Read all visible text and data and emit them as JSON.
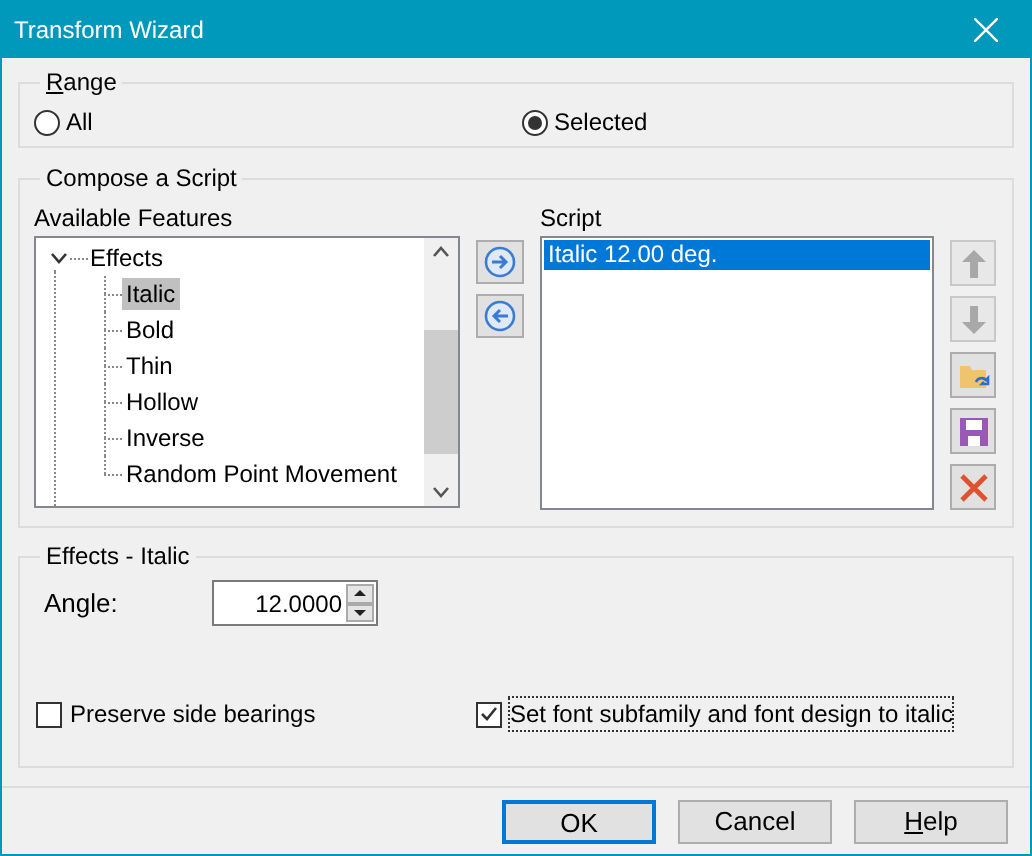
{
  "window": {
    "title": "Transform Wizard"
  },
  "range": {
    "title": "Range",
    "mnemonic": true,
    "options": [
      {
        "label": "All",
        "selected": false
      },
      {
        "label": "Selected",
        "selected": true
      }
    ]
  },
  "compose": {
    "title": "Compose a Script",
    "features_label": "Available Features",
    "features": [
      {
        "label": "Effects",
        "expanded": true,
        "selected": false,
        "children": [
          {
            "label": "Italic",
            "selected": true
          },
          {
            "label": "Bold",
            "selected": false
          },
          {
            "label": "Thin",
            "selected": false
          },
          {
            "label": "Hollow",
            "selected": false
          },
          {
            "label": "Inverse",
            "selected": false
          },
          {
            "label": "Random Point Movement",
            "selected": false
          }
        ]
      }
    ],
    "script_label": "Script",
    "script": [
      {
        "label": "Italic 12.00 deg.",
        "selected": true
      }
    ],
    "side_buttons": [
      {
        "kind": "up",
        "disabled": true
      },
      {
        "kind": "down",
        "disabled": true
      },
      {
        "kind": "open",
        "disabled": false
      },
      {
        "kind": "save",
        "disabled": false
      },
      {
        "kind": "delete",
        "disabled": false
      }
    ]
  },
  "effects": {
    "title": "Effects - Italic",
    "angle_label": "Angle:",
    "angle": "12.0000",
    "checkboxes": [
      {
        "label": "Preserve side bearings",
        "checked": false,
        "focused": false
      },
      {
        "label": "Set font subfamily and font design to italic",
        "checked": true,
        "focused": true
      }
    ]
  },
  "buttons": [
    {
      "label": "OK",
      "default": true,
      "mnemonic": false
    },
    {
      "label": "Cancel",
      "default": false,
      "mnemonic": false
    },
    {
      "label": "Help",
      "default": false,
      "mnemonic": true
    }
  ]
}
